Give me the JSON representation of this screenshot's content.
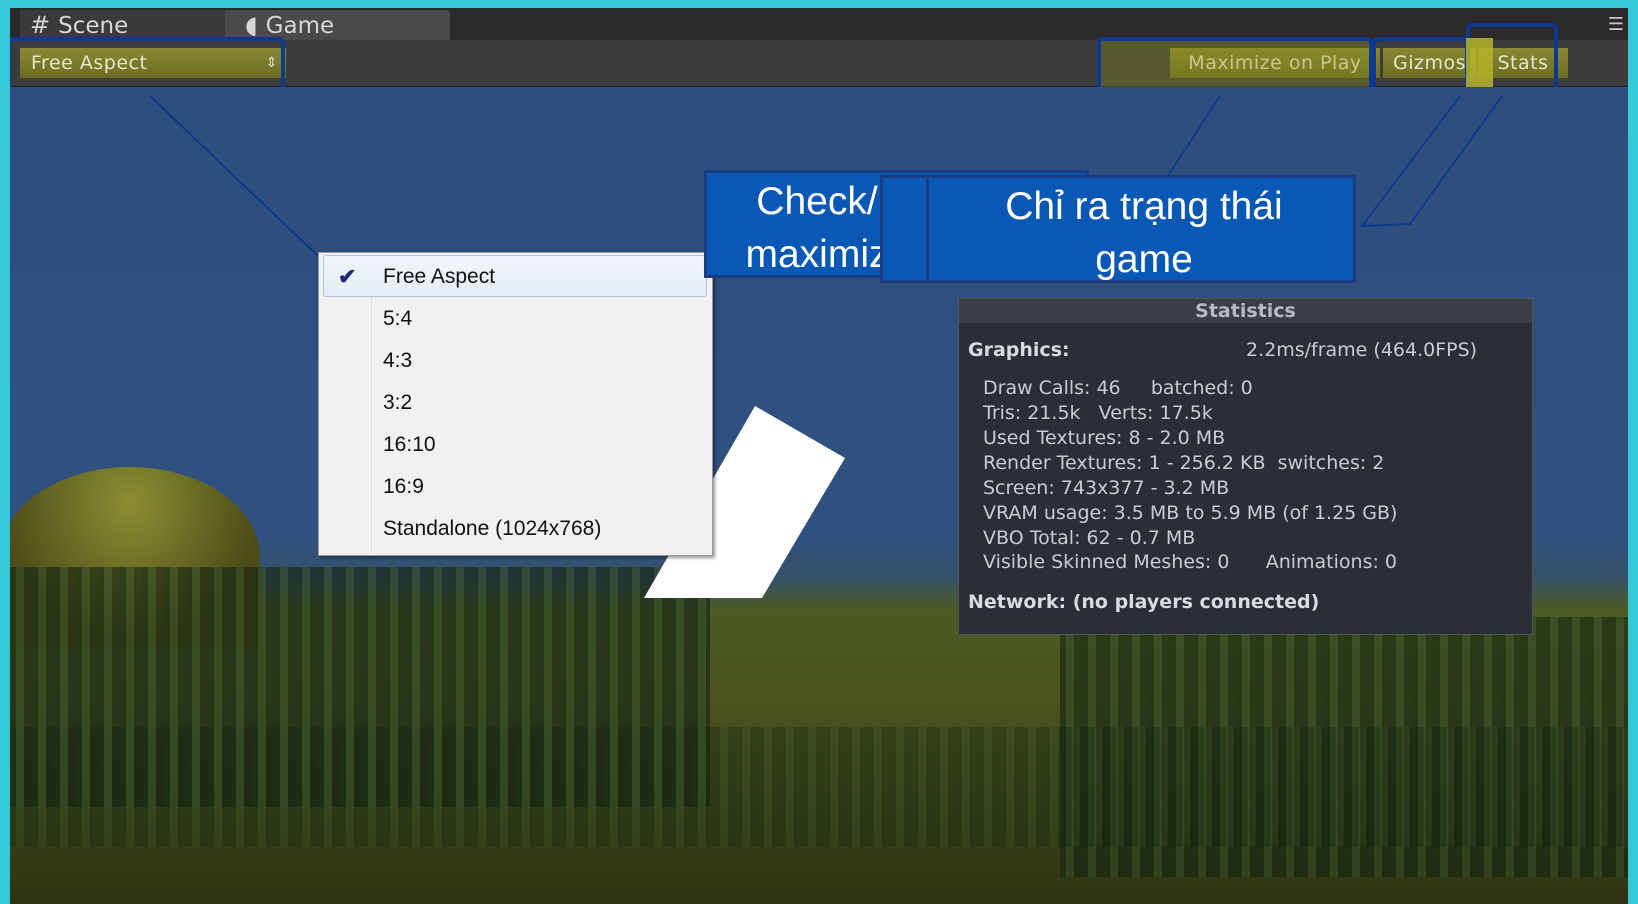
{
  "tabs": {
    "scene": {
      "icon": "grid-icon",
      "label": "Scene"
    },
    "game": {
      "icon": "pacman-icon",
      "label": "Game"
    }
  },
  "toolbar": {
    "aspect_label": "Free Aspect",
    "maximize_label": "Maximize on Play",
    "gizmos_label": "Gizmos",
    "stats_label": "Stats"
  },
  "aspect_menu": {
    "selected": "Free Aspect",
    "items": [
      "Free Aspect",
      "5:4",
      "4:3",
      "3:2",
      "16:10",
      "16:9",
      "Standalone (1024x768)"
    ]
  },
  "callouts": {
    "maximize_line1": "Check/",
    "maximize_line2": "maximiz",
    "stats_line1": "Chỉ ra trạng thái",
    "stats_line2": "game"
  },
  "stats": {
    "title": "Statistics",
    "graphics_label": "Graphics:",
    "graphics_value": "2.2ms/frame (464.0FPS)",
    "lines": [
      "Draw Calls: 46     batched: 0",
      "Tris: 21.5k   Verts: 17.5k",
      "Used Textures: 8 - 2.0 MB",
      "Render Textures: 1 - 256.2 KB  switches: 2",
      "Screen: 743x377 - 3.2 MB",
      "VRAM usage: 3.5 MB to 5.9 MB (of 1.25 GB)",
      "VBO Total: 62 - 0.7 MB",
      "Visible Skinned Meshes: 0      Animations: 0"
    ],
    "network": "Network: (no players connected)"
  },
  "colors": {
    "callout_fill": "#0a58b6",
    "highlight_border": "#0d3a8e",
    "highlight_fill": "#8c8c1e",
    "outer_background": "#33c9d6"
  }
}
